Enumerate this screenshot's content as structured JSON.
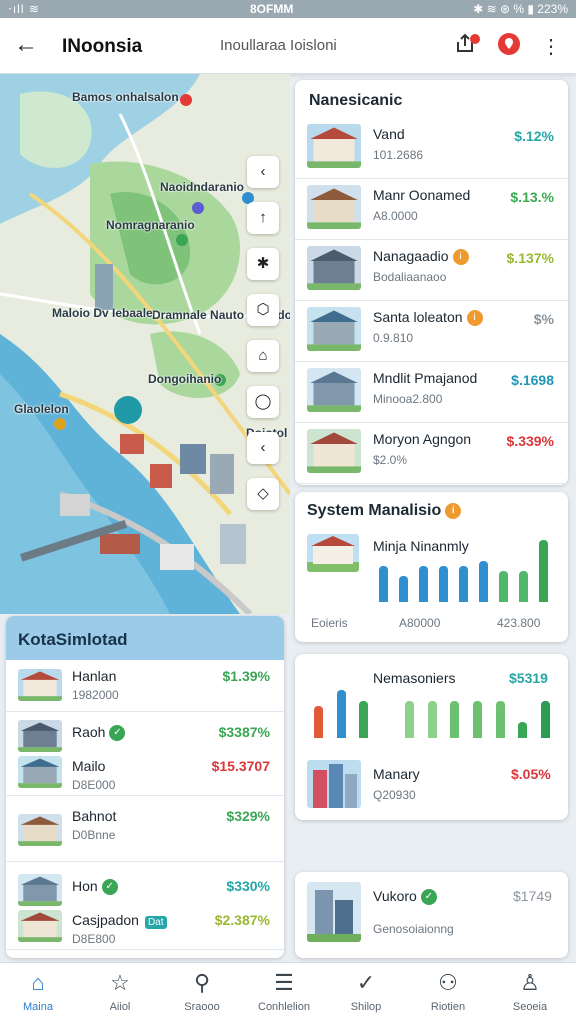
{
  "status_bar": {
    "left": "⋅ıll ≋",
    "time": "8OFMM",
    "right": "✱ ≋ ⊛ % ▮ 223%"
  },
  "app_bar": {
    "title": "INoonsia",
    "search_text": "Inoullaraa Ioisloni",
    "back_icon": "arrow-left-icon",
    "share_icon": "share-icon",
    "pin_icon": "map-pin-icon",
    "more_icon": "more-vertical-icon"
  },
  "map": {
    "labels": [
      "Bamos onhalsalon",
      "Naoidndaranio",
      "Nomragnaranio",
      "Dramnale Nauto Reoodo",
      "Maloio Dv Iebaale",
      "Dongoihanio",
      "Glaolelon",
      "Doiotol"
    ],
    "tools": [
      "‹",
      "↑",
      "✱",
      "⬡",
      "⌂",
      "◯",
      "‹",
      "◇"
    ]
  },
  "listings": {
    "title": "Nanesicanic",
    "items": [
      {
        "name": "Vand",
        "sub": "101.2686",
        "value": "$.12%",
        "color": "#26a6a6",
        "badge": null
      },
      {
        "name": "Manr Oonamed",
        "sub": "A8.0000",
        "value": "$.13.%",
        "color": "#3aaa52",
        "badge": null
      },
      {
        "name": "Nanagaadio",
        "sub": "Bodaliaanaoo",
        "value": "$.137%",
        "color": "#9ab832",
        "badge": "orange"
      },
      {
        "name": "Santa loleaton",
        "sub": "0.9.810",
        "value": "$%",
        "color": "#8a949c",
        "badge": "orange"
      },
      {
        "name": "Mndlit Pmajanod",
        "sub": "Minooa2.800",
        "value": "$.1698",
        "color": "#1f97b8",
        "badge": null
      },
      {
        "name": "Moryon Agngon",
        "sub": "$2.0%",
        "value": "$.339%",
        "color": "#d8383a",
        "badge": null
      }
    ]
  },
  "system": {
    "title": "System Manalisio",
    "item_name": "Minja Ninanmly",
    "axis": [
      "Eoieris",
      "A80000",
      "423.800"
    ],
    "chart_data": {
      "type": "bar",
      "values": [
        7,
        5,
        7,
        7,
        7,
        8,
        6,
        6,
        12
      ],
      "colors": [
        "#2f8fcf",
        "#2f8fcf",
        "#2f8fcf",
        "#2f8fcf",
        "#2f8fcf",
        "#2f8fcf",
        "#4fb86a",
        "#4fb86a",
        "#3aa655"
      ]
    }
  },
  "monitor": {
    "title": "Nemasoniers",
    "value": "$5319",
    "item_name": "Manary",
    "item_sub": "Q20930",
    "item_value": "$.05%",
    "chart_data": {
      "type": "bar",
      "values": [
        6,
        9,
        7,
        0,
        7,
        7,
        7,
        7,
        7,
        3,
        7
      ],
      "colors": [
        "#e05a3a",
        "#2f8fcf",
        "#3aa655",
        "#ffffff",
        "#8fd08a",
        "#8fd08a",
        "#6cc070",
        "#6cc070",
        "#6cc070",
        "#3aa655",
        "#2e9b55"
      ]
    }
  },
  "last_card": {
    "name": "Vukoro",
    "sub": "Genosoiaionng",
    "value": "$1749"
  },
  "kota": {
    "title": "KotaSimlotad",
    "rows": [
      {
        "name": "Hanlan",
        "sub": "1982000",
        "value": "$1.39%",
        "color": "#3aa655"
      },
      {
        "name": "Raoh",
        "sub": "",
        "value": "$3387%",
        "color": "#3aa655"
      },
      {
        "name": "Mailo",
        "sub": "D8E000",
        "value": "$15.3707",
        "color": "#d8383a"
      },
      {
        "name": "Bahnot",
        "sub": "D0Bnne",
        "value": "$329%",
        "color": "#3aa655"
      },
      {
        "name": "Hon",
        "sub": "",
        "value": "$330%",
        "color": "#26a6a6"
      },
      {
        "name": "Casjpadon",
        "sub": "D8E800",
        "value": "$2.387%",
        "color": "#9ab832",
        "tag": "Dat"
      }
    ]
  },
  "nav": [
    {
      "label": "Maina",
      "icon": "home-icon",
      "glyph": "⌂",
      "active": true
    },
    {
      "label": "Aiiol",
      "icon": "star-icon",
      "glyph": "☆",
      "active": false
    },
    {
      "label": "Sraooo",
      "icon": "search-icon",
      "glyph": "⚲",
      "active": false
    },
    {
      "label": "Conhlelion",
      "icon": "database-icon",
      "glyph": "☰",
      "active": false
    },
    {
      "label": "Shilop",
      "icon": "check-icon",
      "glyph": "✓",
      "active": false
    },
    {
      "label": "Riotien",
      "icon": "people-icon",
      "glyph": "⚇",
      "active": false
    },
    {
      "label": "Seoeia",
      "icon": "user-icon",
      "glyph": "♙",
      "active": false
    }
  ]
}
